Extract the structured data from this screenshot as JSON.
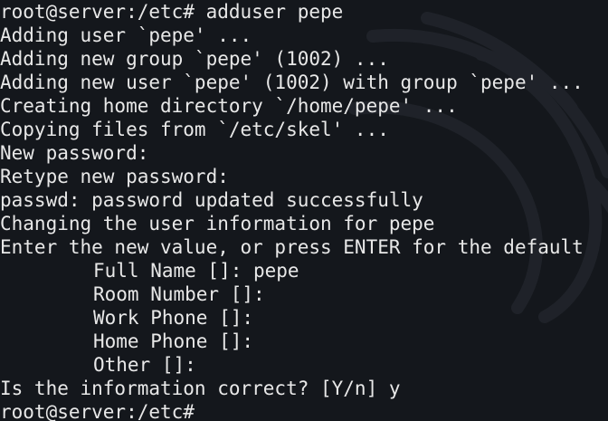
{
  "terminal": {
    "watermark_icon": "kali-dragon-logo",
    "background": "#14171c",
    "text_color": "#e8e8e8",
    "lines": [
      "root@server:/etc# adduser pepe",
      "Adding user `pepe' ...",
      "Adding new group `pepe' (1002) ...",
      "Adding new user `pepe' (1002) with group `pepe' ...",
      "Creating home directory `/home/pepe' ...",
      "Copying files from `/etc/skel' ...",
      "New password:",
      "Retype new password:",
      "passwd: password updated successfully",
      "Changing the user information for pepe",
      "Enter the new value, or press ENTER for the default",
      "Full Name []: pepe",
      "Room Number []:",
      "Work Phone []:",
      "Home Phone []:",
      "Other []:",
      "Is the information correct? [Y/n] y",
      "root@server:/etc#"
    ]
  }
}
